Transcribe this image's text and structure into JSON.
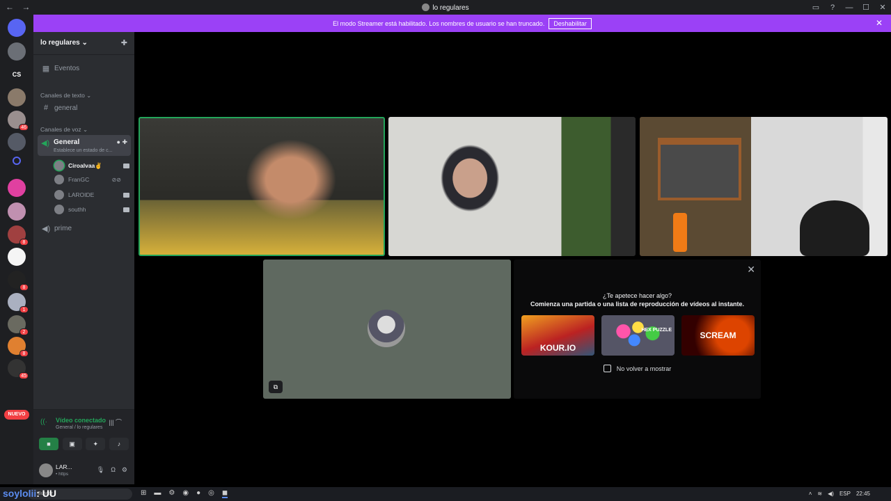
{
  "window": {
    "title": "lo regulares",
    "back": "←",
    "forward": "→",
    "controls": [
      "▭",
      "?",
      "—",
      "☐",
      "✕"
    ]
  },
  "banner": {
    "text": "El modo Streamer está habilitado. Los nombres de usuario se han truncado.",
    "button": "Deshabilitar",
    "close": "✕"
  },
  "guilds": {
    "items": [
      {
        "name": "discord-home",
        "text": ""
      },
      {
        "name": "guild-1",
        "text": ""
      },
      {
        "name": "guild-cs",
        "text": "CS"
      },
      {
        "name": "guild-3",
        "text": ""
      },
      {
        "name": "guild-4",
        "text": "",
        "badge": "46"
      },
      {
        "name": "guild-5",
        "text": ""
      },
      {
        "name": "guild-6",
        "text": ""
      },
      {
        "name": "guild-7",
        "text": ""
      },
      {
        "name": "guild-8",
        "text": ""
      },
      {
        "name": "guild-9",
        "text": "",
        "badge": "8"
      },
      {
        "name": "guild-10",
        "text": ""
      },
      {
        "name": "guild-11",
        "text": "",
        "badge": "8"
      },
      {
        "name": "guild-12",
        "text": "",
        "badge": "1"
      },
      {
        "name": "guild-13",
        "text": "",
        "badge": "2"
      },
      {
        "name": "guild-14",
        "text": "",
        "badge": "8"
      },
      {
        "name": "guild-15",
        "text": "",
        "badge": "45"
      }
    ],
    "nuevo": "NUEVO"
  },
  "sidebar": {
    "server_name": "lo regulares ⌄",
    "events": "Eventos",
    "text_category": "Canales de texto ⌄",
    "text_channel": "general",
    "voice_category": "Canales de voz ⌄",
    "active_voice": {
      "name": "General",
      "status": "Establece un estado de c..."
    },
    "members": [
      {
        "name": "Ciroalvaa✌",
        "speaking": true
      },
      {
        "name": "FranGC",
        "speaking": false
      },
      {
        "name": "LAROIDE",
        "speaking": false
      },
      {
        "name": "southh",
        "speaking": false
      }
    ],
    "other_voice": "prime"
  },
  "voice_panel": {
    "connected": "Vídeo conectado",
    "channel": "General / lo regulares"
  },
  "user": {
    "name": "LAR...",
    "status": "• https"
  },
  "activity": {
    "question": "¿Te apetece hacer algo?",
    "description": "Comienza una partida o una lista de reproducción de vídeos al instante.",
    "cards": [
      "KOUR.IO",
      "HEX PUZZLE",
      "SCREAM"
    ],
    "checkbox": "No volver a mostrar"
  },
  "taskbar": {
    "brand": "soylolii",
    "brand_suffix": ": UU",
    "search": "Buscar",
    "lang": "ESP",
    "time": "22:45"
  }
}
